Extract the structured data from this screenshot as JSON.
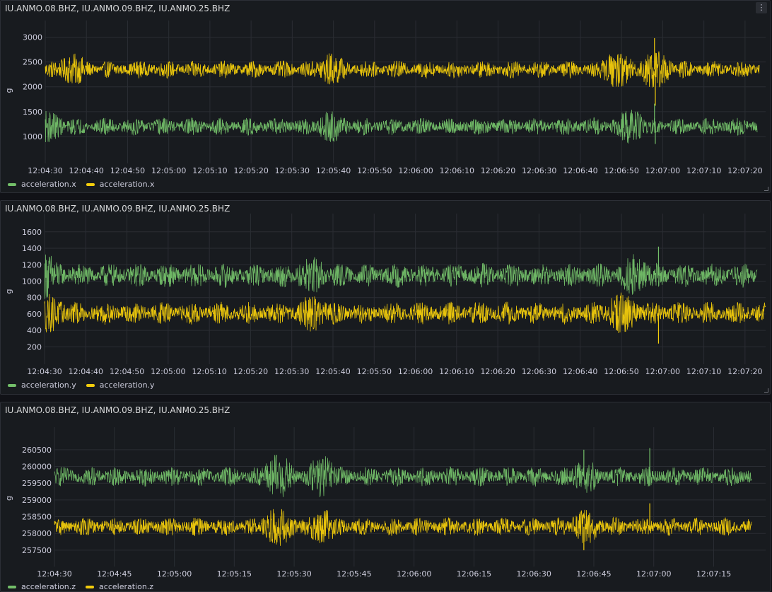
{
  "panels": [
    {
      "title": "IU.ANMO.08.BHZ, IU.ANMO.09.BHZ, IU.ANMO.25.BHZ",
      "has_menu": true,
      "legend": [
        {
          "name": "acceleration.x",
          "color": "#73bf69"
        },
        {
          "name": "acceleration.x",
          "color": "#f2cc0c"
        }
      ]
    },
    {
      "title": "IU.ANMO.08.BHZ, IU.ANMO.09.BHZ, IU.ANMO.25.BHZ",
      "has_menu": false,
      "legend": [
        {
          "name": "acceleration.y",
          "color": "#73bf69"
        },
        {
          "name": "acceleration.y",
          "color": "#f2cc0c"
        }
      ]
    },
    {
      "title": "IU.ANMO.08.BHZ, IU.ANMO.09.BHZ, IU.ANMO.25.BHZ",
      "has_menu": false,
      "legend": [
        {
          "name": "acceleration.z",
          "color": "#73bf69"
        },
        {
          "name": "acceleration.z",
          "color": "#f2cc0c"
        }
      ]
    }
  ],
  "menu_icon": "kebab-icon",
  "chart_data": [
    {
      "type": "line",
      "ylabel": "g",
      "ylim": [
        800,
        3050
      ],
      "yticks": [
        1000,
        1500,
        2000,
        2500,
        3000
      ],
      "x_range": [
        "12:04:30",
        "12:07:25"
      ],
      "x_tick_labels": [
        "12:04:30",
        "12:04:40",
        "12:04:50",
        "12:05:00",
        "12:05:10",
        "12:05:20",
        "12:05:30",
        "12:05:40",
        "12:05:50",
        "12:06:00",
        "12:06:10",
        "12:06:20",
        "12:06:30",
        "12:06:40",
        "12:06:50",
        "12:07:00",
        "12:07:10",
        "12:07:20"
      ],
      "x_tick_seconds": [
        0,
        10,
        20,
        30,
        40,
        50,
        60,
        70,
        80,
        90,
        100,
        110,
        120,
        130,
        140,
        150,
        160,
        170
      ],
      "x_max_seconds": 175,
      "grid": true,
      "legend_position": "bottom-left",
      "series": [
        {
          "color": "#f2cc0c",
          "center": 2350,
          "amplitude": 180,
          "start_s": 0,
          "end_s": 173.5,
          "bursts": [
            {
              "t": 7,
              "amp": 320
            },
            {
              "t": 69.5,
              "amp": 340
            },
            {
              "t": 139,
              "amp": 380
            },
            {
              "t": 148,
              "amp": 420
            }
          ],
          "spikes": [
            {
              "t": 148,
              "value": 2980
            },
            {
              "t": 148.2,
              "value": 1620
            }
          ]
        },
        {
          "color": "#73bf69",
          "center": 1200,
          "amplitude": 180,
          "start_s": 0,
          "end_s": 173,
          "bursts": [
            {
              "t": 0.5,
              "amp": 330
            },
            {
              "t": 69.5,
              "amp": 320
            },
            {
              "t": 142,
              "amp": 360
            }
          ],
          "spikes": [
            {
              "t": 148,
              "value": 1660
            },
            {
              "t": 148.2,
              "value": 850
            }
          ]
        }
      ]
    },
    {
      "type": "line",
      "ylabel": "g",
      "ylim": [
        100,
        1650
      ],
      "yticks": [
        200,
        400,
        600,
        800,
        1000,
        1200,
        1400,
        1600
      ],
      "x_range": [
        "12:04:30",
        "12:07:25"
      ],
      "x_tick_labels": [
        "12:04:30",
        "12:04:40",
        "12:04:50",
        "12:05:00",
        "12:05:10",
        "12:05:20",
        "12:05:30",
        "12:05:40",
        "12:05:50",
        "12:06:00",
        "12:06:10",
        "12:06:20",
        "12:06:30",
        "12:06:40",
        "12:06:50",
        "12:07:00",
        "12:07:10",
        "12:07:20"
      ],
      "x_tick_seconds": [
        0,
        10,
        20,
        30,
        40,
        50,
        60,
        70,
        80,
        90,
        100,
        110,
        120,
        130,
        140,
        150,
        160,
        170
      ],
      "x_max_seconds": 175,
      "grid": true,
      "legend_position": "bottom-left",
      "series": [
        {
          "color": "#73bf69",
          "center": 1070,
          "amplitude": 150,
          "start_s": 0,
          "end_s": 173,
          "bursts": [
            {
              "t": 0.3,
              "amp": 290
            },
            {
              "t": 65,
              "amp": 230
            },
            {
              "t": 143,
              "amp": 260
            }
          ],
          "spikes": [
            {
              "t": 149,
              "value": 1420
            }
          ]
        },
        {
          "color": "#f2cc0c",
          "center": 610,
          "amplitude": 140,
          "start_s": 0,
          "end_s": 175,
          "bursts": [
            {
              "t": 1,
              "amp": 240
            },
            {
              "t": 65,
              "amp": 230
            },
            {
              "t": 140,
              "amp": 260
            }
          ],
          "spikes": [
            {
              "t": 149,
              "value": 240
            }
          ]
        }
      ]
    },
    {
      "type": "line",
      "ylabel": "g",
      "ylim": [
        257350,
        260750
      ],
      "yticks": [
        257500,
        258000,
        258500,
        259000,
        259500,
        260000,
        260500
      ],
      "x_range": [
        "12:04:30",
        "12:07:28"
      ],
      "x_tick_labels": [
        "12:04:30",
        "12:04:45",
        "12:05:00",
        "12:05:15",
        "12:05:30",
        "12:05:45",
        "12:06:00",
        "12:06:15",
        "12:06:30",
        "12:06:45",
        "12:07:00",
        "12:07:15"
      ],
      "x_tick_seconds": [
        0,
        15,
        30,
        45,
        60,
        75,
        90,
        105,
        120,
        135,
        150,
        165
      ],
      "x_max_seconds": 178,
      "grid": true,
      "legend_position": "bottom-left",
      "series": [
        {
          "color": "#73bf69",
          "center": 259700,
          "amplitude": 300,
          "start_s": 0,
          "end_s": 174.5,
          "bursts": [
            {
              "t": 56,
              "amp": 700
            },
            {
              "t": 67,
              "amp": 650
            },
            {
              "t": 133,
              "amp": 500
            }
          ],
          "spikes": [
            {
              "t": 132.5,
              "value": 260500
            },
            {
              "t": 149,
              "value": 260550
            }
          ]
        },
        {
          "color": "#f2cc0c",
          "center": 258200,
          "amplitude": 280,
          "start_s": 0,
          "end_s": 174.5,
          "bursts": [
            {
              "t": 56,
              "amp": 600
            },
            {
              "t": 67,
              "amp": 560
            },
            {
              "t": 133,
              "amp": 520
            }
          ],
          "spikes": [
            {
              "t": 132.5,
              "value": 257500
            },
            {
              "t": 149,
              "value": 258900
            }
          ]
        }
      ]
    }
  ]
}
